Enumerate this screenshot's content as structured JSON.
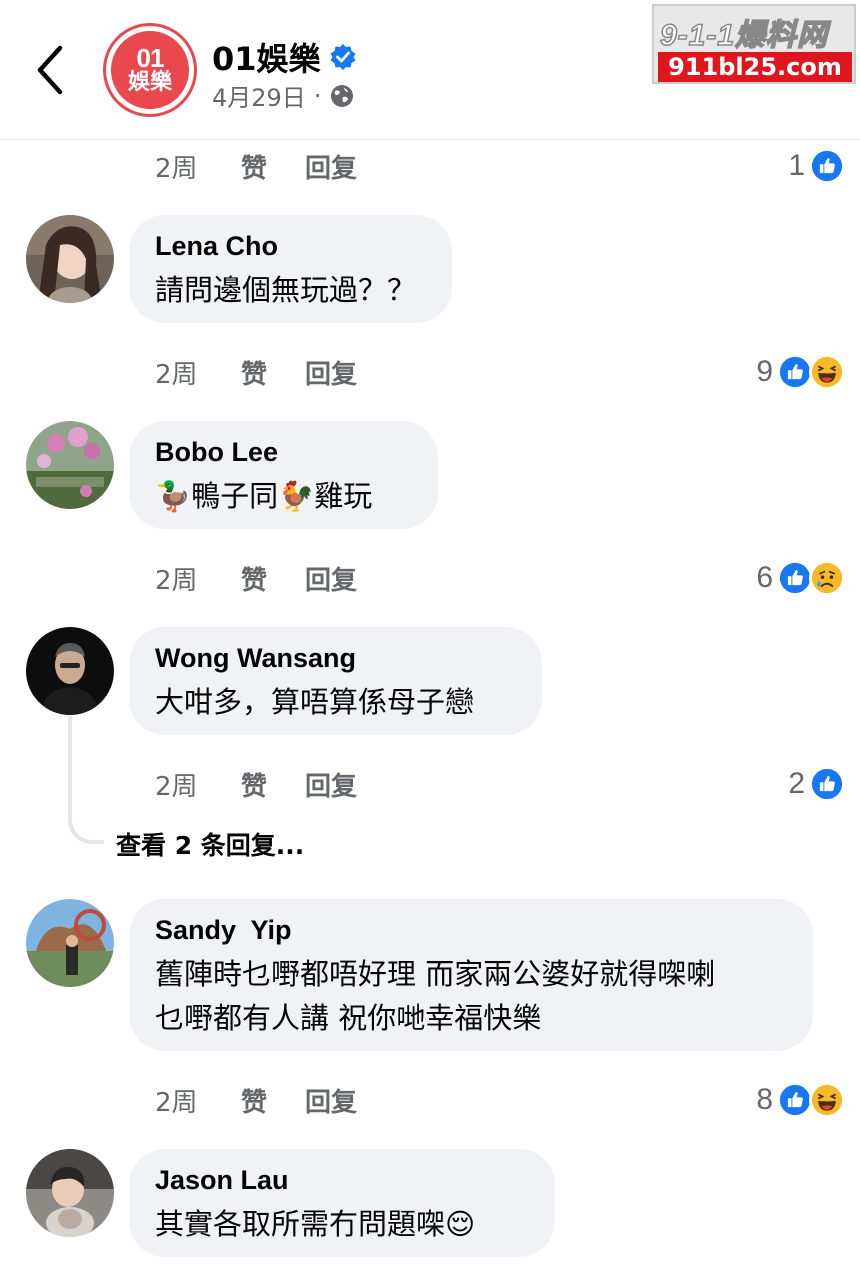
{
  "header": {
    "back_label": "back",
    "page_avatar_number": "01",
    "page_avatar_text": "娛樂",
    "page_name": "01娛樂",
    "post_date": "4月29日",
    "separator": "·"
  },
  "watermark": {
    "top_text": "9-1-1爆料网",
    "bottom_text": "911bl25.com"
  },
  "comments": [
    {
      "time": "2周",
      "like_label": "赞",
      "reply_label": "回复",
      "reaction_count": "1",
      "reactions": [
        "like"
      ]
    },
    {
      "author": "Lena Cho",
      "text": "請問邊個無玩過？？",
      "time": "2周",
      "like_label": "赞",
      "reply_label": "回复",
      "reaction_count": "9",
      "reactions": [
        "like",
        "haha"
      ]
    },
    {
      "author": "Bobo Lee",
      "text": "🦆鴨子同🐓雞玩",
      "time": "2周",
      "like_label": "赞",
      "reply_label": "回复",
      "reaction_count": "6",
      "reactions": [
        "like",
        "sad"
      ]
    },
    {
      "author": "Wong Wansang",
      "text": "大咁多，算唔算係母子戀",
      "time": "2周",
      "like_label": "赞",
      "reply_label": "回复",
      "reaction_count": "2",
      "reactions": [
        "like"
      ],
      "view_replies": "查看 2 条回复..."
    },
    {
      "author": "Sandy  Yip",
      "text_line1": "舊陣時乜嘢都唔好理 而家兩公婆好就得㗎喇",
      "text_line2": "乜嘢都有人講 祝你哋幸福快樂",
      "time": "2周",
      "like_label": "赞",
      "reply_label": "回复",
      "reaction_count": "8",
      "reactions": [
        "like",
        "haha"
      ]
    },
    {
      "author": "Jason Lau",
      "text": "其實各取所需冇問題㗎😌"
    }
  ],
  "colors": {
    "like_blue": "#1877f2",
    "haha_yellow": "#f7b928",
    "brand_red": "#e8484e",
    "bubble_bg": "#f0f2f5",
    "meta_gray": "#65676b"
  }
}
